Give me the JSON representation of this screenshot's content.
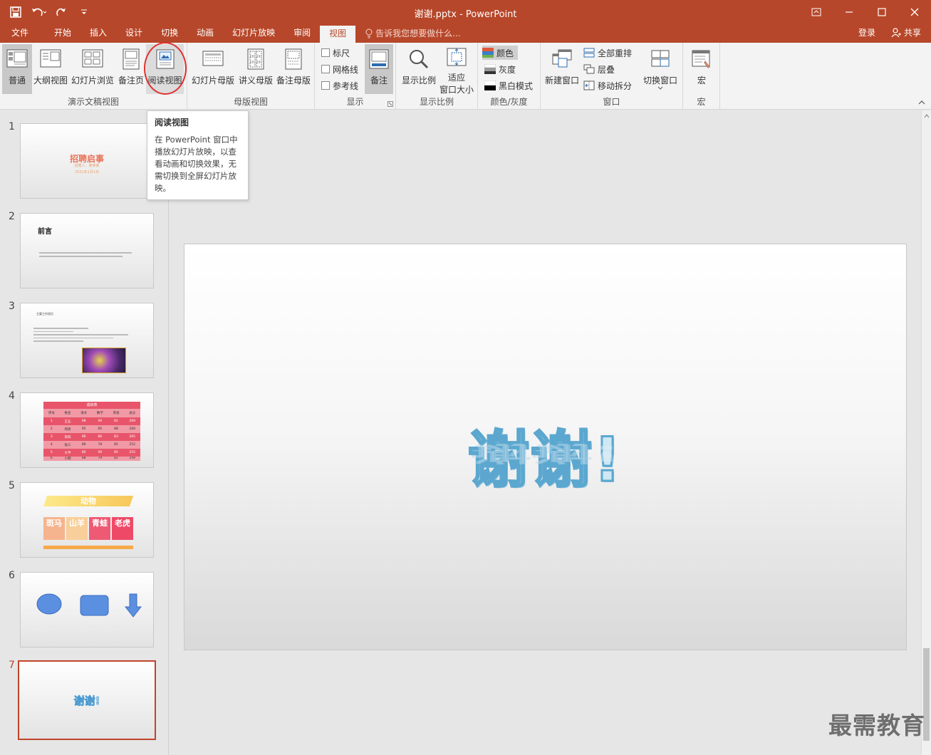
{
  "window": {
    "title": "谢谢.pptx - PowerPoint"
  },
  "qat": {
    "save_icon": "save-icon",
    "undo_icon": "undo-icon",
    "redo_icon": "redo-icon",
    "customize_icon": "customize-icon"
  },
  "tabs": [
    {
      "label": "文件"
    },
    {
      "label": "开始"
    },
    {
      "label": "插入"
    },
    {
      "label": "设计"
    },
    {
      "label": "切换"
    },
    {
      "label": "动画"
    },
    {
      "label": "幻灯片放映"
    },
    {
      "label": "审阅"
    },
    {
      "label": "视图",
      "active": true
    }
  ],
  "tellme": "告诉我您想要做什么...",
  "account": {
    "signin": "登录",
    "share": "共享"
  },
  "ribbon": {
    "presentation_views": {
      "label": "演示文稿视图",
      "normal": "普通",
      "outline": "大纲视图",
      "sorter": "幻灯片浏览",
      "notes_page": "备注页",
      "reading": "阅读视图"
    },
    "master_views": {
      "label": "母版视图",
      "slide_master": "幻灯片母版",
      "handout_master": "讲义母版",
      "notes_master": "备注母版"
    },
    "show": {
      "label": "显示",
      "ruler": "标尺",
      "gridlines": "网格线",
      "guides": "参考线",
      "notes": "备注"
    },
    "zoom": {
      "label": "显示比例",
      "zoom": "显示比例",
      "fit_line1": "适应",
      "fit_line2": "窗口大小"
    },
    "color": {
      "label": "颜色/灰度",
      "color": "颜色",
      "grayscale": "灰度",
      "bw": "黑白模式"
    },
    "window": {
      "label": "窗口",
      "new_window": "新建窗口",
      "arrange_all": "全部重排",
      "cascade": "层叠",
      "move_split": "移动拆分",
      "switch_windows": "切换窗口"
    },
    "macros": {
      "label": "宏",
      "macros": "宏"
    }
  },
  "tooltip": {
    "title": "阅读视图",
    "body": "在 PowerPoint 窗口中播放幻灯片放映，以查看动画和切换效果，无需切换到全屏幻灯片放映。"
  },
  "thumbnails": {
    "nums": [
      "1",
      "2",
      "3",
      "4",
      "5",
      "6",
      "7"
    ],
    "s1_title": "招聘启事",
    "s1_sub": "招聘人：某某某",
    "s1_date": "2021年1月1日",
    "s2_title": "前言",
    "s3_title": "主要工作经历",
    "s4_title": "成绩表",
    "s4_headers": [
      "序号",
      "姓名",
      "语文",
      "数学",
      "英语",
      "总分"
    ],
    "s4_rows": [
      [
        "1",
        "王五",
        "98",
        "90",
        "81",
        "269"
      ],
      [
        "2",
        "周周",
        "95",
        "85",
        "88",
        "268"
      ],
      [
        "3",
        "李四",
        "96",
        "86",
        "83",
        "265"
      ],
      [
        "4",
        "张三",
        "89",
        "78",
        "85",
        "252"
      ],
      [
        "5",
        "大平",
        "80",
        "90",
        "85",
        "255"
      ],
      [
        "6",
        "小明",
        "88",
        "79",
        "82",
        "249"
      ]
    ],
    "s5_title": "动物",
    "s5_cards": [
      "斑马",
      "山羊",
      "青蛙",
      "老虎"
    ],
    "s7_text": "谢谢!"
  },
  "slide": {
    "text": "谢谢!"
  },
  "watermark": "最需教育",
  "colors": {
    "accent": "#b7472a",
    "selected_thumb_border": "#c0432b",
    "ring": "#e03030"
  }
}
